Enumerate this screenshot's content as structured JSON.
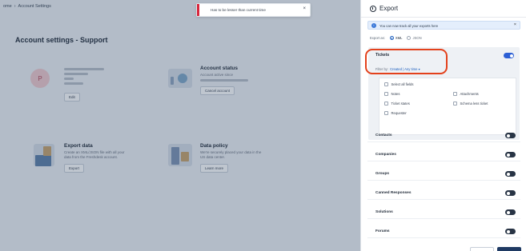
{
  "background": {
    "breadcrumb": {
      "prev": "ome",
      "current": "Account Settings"
    },
    "page_title": "Account settings - Support",
    "profile_card": {
      "avatar_letter": "P",
      "button": "Edit"
    },
    "account_status": {
      "title": "Account status",
      "line1": "Account active since",
      "button": "Cancel account"
    },
    "export_data": {
      "title": "Export data",
      "line1": "Create an XML/JSON file with all your",
      "line2": "data from the Freshdesk account.",
      "button": "Export"
    },
    "data_policy": {
      "title": "Data policy",
      "line1": "We're securely placed your data in the",
      "line2": "US data center.",
      "button": "Learn more"
    }
  },
  "toast": {
    "message": "Has to be lesser than current time",
    "close": "×"
  },
  "panel": {
    "title": "Export",
    "info": {
      "text": "You can now track all your exports here",
      "close": "×"
    },
    "export_as": {
      "label": "Export as:",
      "options": [
        "XML",
        "JSON"
      ],
      "selected": "XML"
    },
    "tickets": {
      "title": "Tickets",
      "enabled": true,
      "filter_label": "Filter by:",
      "filter_value": "Created | Any time ▾",
      "options": [
        "Select all fields",
        "Notes",
        "Attachments",
        "Ticket states",
        "Schema less ticket",
        "Requester"
      ]
    },
    "sections": [
      {
        "label": "Contacts",
        "enabled": false
      },
      {
        "label": "Companies",
        "enabled": false
      },
      {
        "label": "Groups",
        "enabled": false
      },
      {
        "label": "Canned Responses",
        "enabled": false
      },
      {
        "label": "Solutions",
        "enabled": false
      },
      {
        "label": "Forums",
        "enabled": false
      }
    ]
  },
  "colors": {
    "accent": "#2c5fd4",
    "highlight": "#e3411c",
    "toast_bar": "#d7263d"
  }
}
